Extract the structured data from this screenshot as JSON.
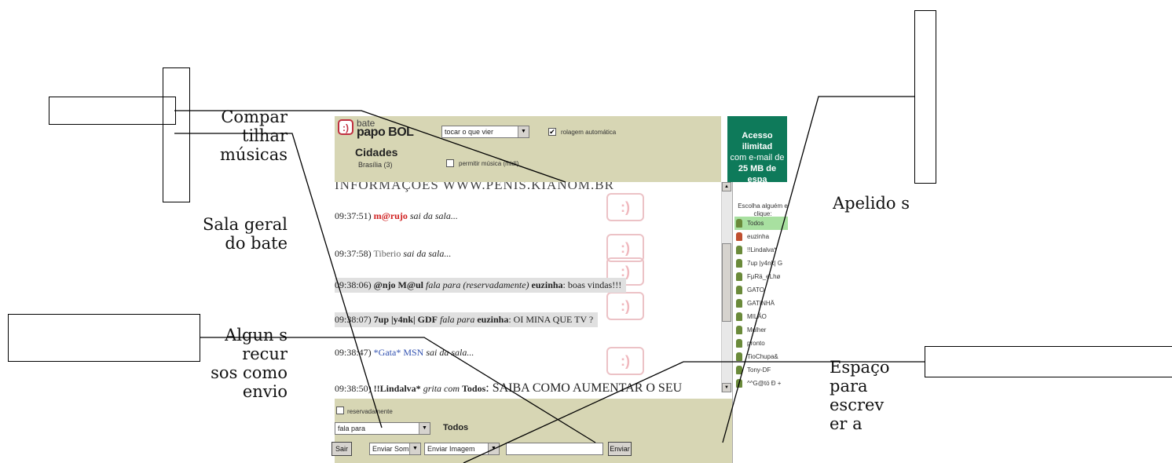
{
  "annotations": {
    "compartilhar": "Compar tilhar músicas",
    "sala": "Sala geral do bate",
    "alguns": "Algun s recur sos como envio",
    "apelidos": "Apelido s",
    "espaco": "Espaço para escrev er a"
  },
  "header": {
    "logo_small": "bate",
    "logo_big": "papo BOL",
    "room_group": "Cidades",
    "room_name": "Brasília (3)",
    "music_select": "tocar o que vier",
    "autoscroll_label": "rolagem automática",
    "autoscroll_checked": "✔",
    "allow_music_label": "permitir música (midi)"
  },
  "ad": {
    "line1": "Acesso ilimitad",
    "line2": "com e-mail de",
    "line3": "25 MB de espa"
  },
  "chat": {
    "top_partial": "INFORMAÇÕES WWW.PENIS.KIANOM.BR",
    "messages": [
      {
        "time": "09:37:51)",
        "nick": "m@rujo",
        "text": "sai da sala..."
      },
      {
        "time": "09:37:58)",
        "nick": "Tiberio",
        "text": "sai da sala..."
      },
      {
        "time": "09:38:06)",
        "nick": "@njo M@ul",
        "action": "fala para (reservadamente)",
        "target": "euzinha",
        "text": ": boas vindas!!!"
      },
      {
        "time": "09:38:07)",
        "nick": "7up |y4nk| GDF",
        "action": "fala para",
        "target": "euzinha",
        "text": ": OI MINA QUE TV ?"
      },
      {
        "time": "09:38:47)",
        "nick": "*Gata* MSN",
        "text": "sai da sala..."
      },
      {
        "time": "09:38:50)",
        "nick": "!!Lindalva*",
        "action": "grita com",
        "target": "Todos",
        "text": ": SAIBA COMO AUMENTAR O SEU"
      }
    ]
  },
  "users": {
    "prompt": "Escolha alguém e clique:",
    "list": [
      "Todos",
      "euzinha",
      "!!Lindalva*",
      "7up |y4nk| G",
      "FμRä_eLhø",
      "GATO",
      "GATINHÄ",
      "MILÃO",
      "Mulher",
      "pronto",
      "TioChupa&",
      "Tony-DF",
      "^^G@tö Ð +"
    ]
  },
  "composer": {
    "reserved_label": "reservadamente",
    "action_select": "fala para",
    "target_label": "Todos",
    "exit_button": "Sair",
    "sound_select": "Enviar Som",
    "image_select": "Enviar Imagem",
    "message_value": "",
    "send_button": "Enviar"
  }
}
